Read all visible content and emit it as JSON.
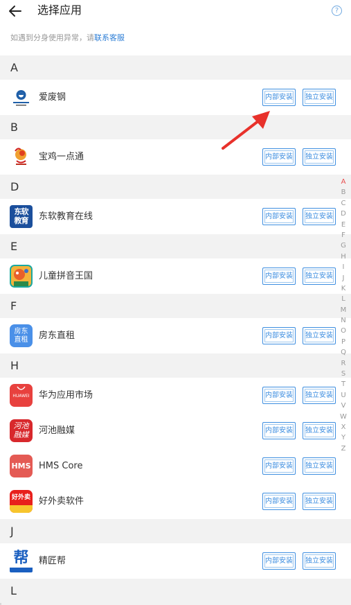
{
  "header": {
    "title": "选择应用",
    "help_symbol": "?",
    "notice_prefix": "如遇到分身使用异常，请",
    "notice_link": "联系客服"
  },
  "buttons": {
    "inner_install": "内部安装",
    "independent_install": "独立安装"
  },
  "sections": [
    {
      "letter": "A",
      "apps": [
        {
          "name": "爱废钢",
          "icon": "aifeigang-icon"
        }
      ]
    },
    {
      "letter": "B",
      "apps": [
        {
          "name": "宝鸡一点通",
          "icon": "baoji-icon"
        }
      ]
    },
    {
      "letter": "D",
      "apps": [
        {
          "name": "东软教育在线",
          "icon": "dongruan-icon",
          "icon_text": "东软教育"
        }
      ]
    },
    {
      "letter": "E",
      "apps": [
        {
          "name": "儿童拼音王国",
          "icon": "pinyin-icon"
        }
      ]
    },
    {
      "letter": "F",
      "apps": [
        {
          "name": "房东直租",
          "icon": "fangdong-icon",
          "icon_text": "房东直租"
        }
      ]
    },
    {
      "letter": "H",
      "apps": [
        {
          "name": "华为应用市场",
          "icon": "huawei-appgallery-icon",
          "icon_text": "HUAWEI"
        },
        {
          "name": "河池融媒",
          "icon": "hechi-icon",
          "icon_text": "河池融媒"
        },
        {
          "name": "HMS Core",
          "icon": "hms-core-icon",
          "icon_text": "HMS"
        },
        {
          "name": "好外卖软件",
          "icon": "haowaimai-icon",
          "icon_text": "好外卖"
        }
      ]
    },
    {
      "letter": "J",
      "apps": [
        {
          "name": "精匠帮",
          "icon": "jingjiangbang-icon",
          "icon_text": "帮"
        }
      ]
    },
    {
      "letter": "L",
      "apps": []
    }
  ],
  "index_bar": [
    "A",
    "B",
    "C",
    "D",
    "E",
    "F",
    "G",
    "H",
    "I",
    "J",
    "K",
    "L",
    "M",
    "N",
    "O",
    "P",
    "Q",
    "R",
    "S",
    "T",
    "U",
    "V",
    "W",
    "X",
    "Y",
    "Z"
  ],
  "index_active": "A",
  "colors": {
    "accent": "#3d8ee0",
    "annotation_arrow": "#e8312b",
    "index_active": "#e84d4d"
  }
}
